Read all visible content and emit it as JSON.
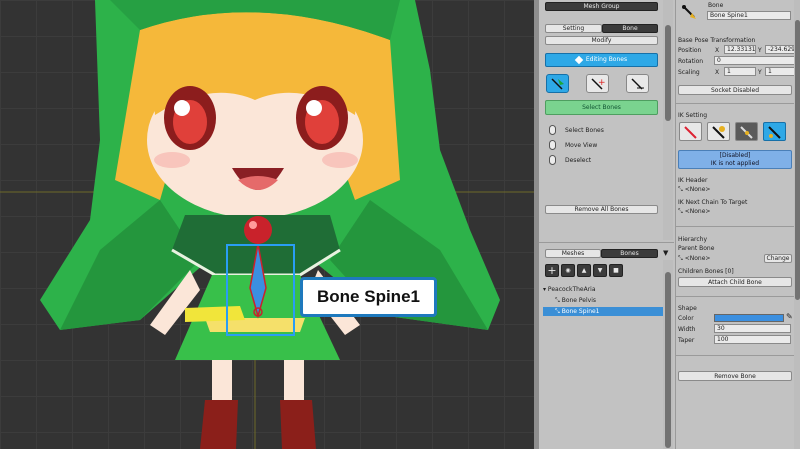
{
  "callout": {
    "text": "Bone Spine1"
  },
  "mid": {
    "header": "Mesh Group",
    "tabs": [
      "Setting",
      "Bone"
    ],
    "modify": "Modify",
    "editing": "Editing Bones",
    "select_bones_btn": "Select Bones",
    "hints": [
      "Select Bones",
      "Move View",
      "Deselect"
    ],
    "remove_all": "Remove All Bones",
    "tabs2": [
      "Meshes",
      "Bones"
    ],
    "tree": {
      "root": "PeacockTheAria",
      "items": [
        "Bone Pelvis",
        "Bone Spine1"
      ]
    }
  },
  "right": {
    "title": "Bone",
    "name": "Bone Spine1",
    "base_pose": "Base Pose Transformation",
    "position_label": "Position",
    "x_label": "X",
    "y_label": "Y",
    "pos_x": "12.33131",
    "pos_y": "-234.629",
    "rotation_label": "Rotation",
    "rotation": "0",
    "scaling_label": "Scaling",
    "scale_x": "1",
    "scale_y": "1",
    "socket": "Socket Disabled",
    "ik_setting": "IK Setting",
    "ik_status_1": "[Disabled]",
    "ik_status_2": "IK is not applied",
    "ik_header": "IK Header",
    "ik_header_val": "<None>",
    "ik_next": "IK Next Chain To Target",
    "ik_next_val": "<None>",
    "hierarchy": "Hierarchy",
    "parent_bone": "Parent Bone",
    "parent_val": "<None>",
    "change": "Change",
    "children": "Children Bones [0]",
    "attach": "Attach Child Bone",
    "shape": "Shape",
    "color_label": "Color",
    "width_label": "Width",
    "width": "30",
    "taper_label": "Taper",
    "taper": "100",
    "remove": "Remove Bone"
  },
  "colors": {
    "accent": "#2ea8e6",
    "bone_color": "#3b8fe0",
    "callout_border": "#1e79bd"
  }
}
